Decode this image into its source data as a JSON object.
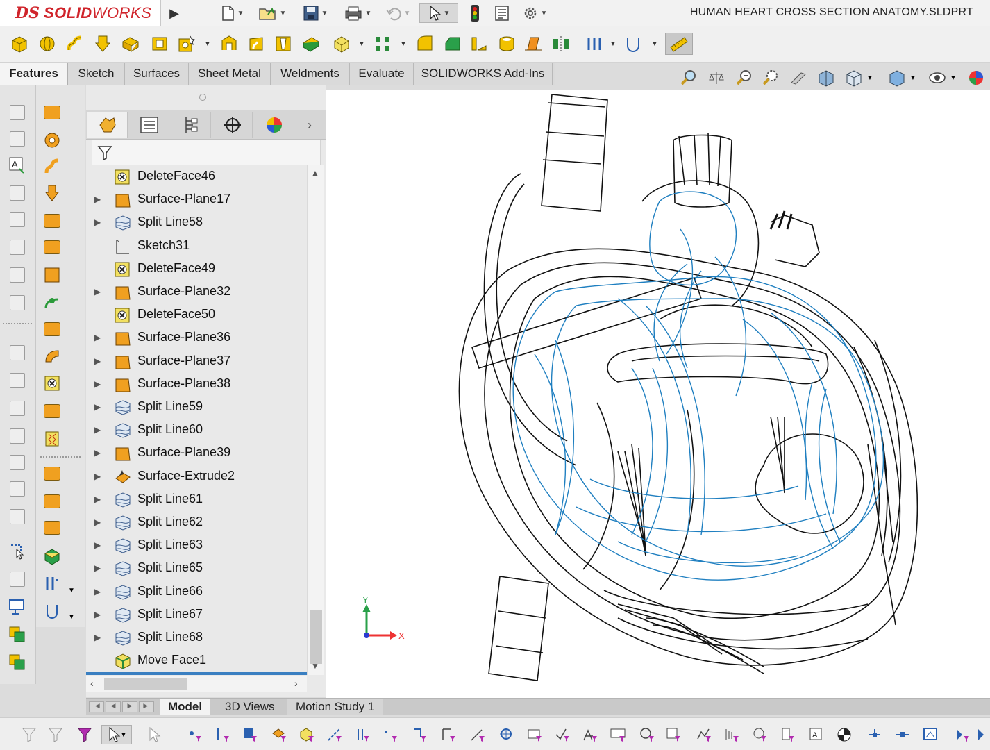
{
  "app": {
    "brand_prefix": "DS",
    "brand_bold": "SOLID",
    "brand_light": "WORKS",
    "document_title": "HUMAN HEART CROSS SECTION ANATOMY.SLDPRT"
  },
  "quick_access": [
    "new-document-icon",
    "open-icon",
    "save-icon",
    "print-icon",
    "undo-icon",
    "select-icon",
    "rebuild-icon",
    "file-properties-icon",
    "options-icon"
  ],
  "command_tabs": [
    {
      "label": "Features",
      "active": true
    },
    {
      "label": "Sketch",
      "active": false
    },
    {
      "label": "Surfaces",
      "active": false
    },
    {
      "label": "Sheet Metal",
      "active": false
    },
    {
      "label": "Weldments",
      "active": false
    },
    {
      "label": "Evaluate",
      "active": false
    },
    {
      "label": "SOLIDWORKS Add-Ins",
      "active": false
    }
  ],
  "feature_tree": [
    {
      "label": "DeleteFace46",
      "type": "deleteface",
      "expandable": false
    },
    {
      "label": "Surface-Plane17",
      "type": "plane",
      "expandable": true
    },
    {
      "label": "Split Line58",
      "type": "splitline",
      "expandable": true
    },
    {
      "label": "Sketch31",
      "type": "sketch",
      "expandable": false
    },
    {
      "label": "DeleteFace49",
      "type": "deleteface",
      "expandable": false
    },
    {
      "label": "Surface-Plane32",
      "type": "plane",
      "expandable": true
    },
    {
      "label": "DeleteFace50",
      "type": "deleteface",
      "expandable": false
    },
    {
      "label": "Surface-Plane36",
      "type": "plane",
      "expandable": true
    },
    {
      "label": "Surface-Plane37",
      "type": "plane",
      "expandable": true
    },
    {
      "label": "Surface-Plane38",
      "type": "plane",
      "expandable": true
    },
    {
      "label": "Split Line59",
      "type": "splitline",
      "expandable": true
    },
    {
      "label": "Split Line60",
      "type": "splitline",
      "expandable": true
    },
    {
      "label": "Surface-Plane39",
      "type": "plane",
      "expandable": true
    },
    {
      "label": "Surface-Extrude2",
      "type": "extrude",
      "expandable": true
    },
    {
      "label": "Split Line61",
      "type": "splitline",
      "expandable": true
    },
    {
      "label": "Split Line62",
      "type": "splitline",
      "expandable": true
    },
    {
      "label": "Split Line63",
      "type": "splitline",
      "expandable": true
    },
    {
      "label": "Split Line65",
      "type": "splitline",
      "expandable": true
    },
    {
      "label": "Split Line66",
      "type": "splitline",
      "expandable": true
    },
    {
      "label": "Split Line67",
      "type": "splitline",
      "expandable": true
    },
    {
      "label": "Split Line68",
      "type": "splitline",
      "expandable": true
    },
    {
      "label": "Move Face1",
      "type": "moveface",
      "expandable": false
    }
  ],
  "bottom_tabs": [
    {
      "label": "Model",
      "active": true
    },
    {
      "label": "3D Views",
      "active": false
    },
    {
      "label": "Motion Study 1",
      "active": false
    }
  ],
  "triad": {
    "x_label": "X",
    "y_label": "Y"
  },
  "colors": {
    "accent_orange": "#f0a020",
    "model_edges": "#111111",
    "hidden_edges": "#1f7fc0",
    "brand_red": "#d0242b",
    "selection_blue": "#3a7fc1"
  }
}
